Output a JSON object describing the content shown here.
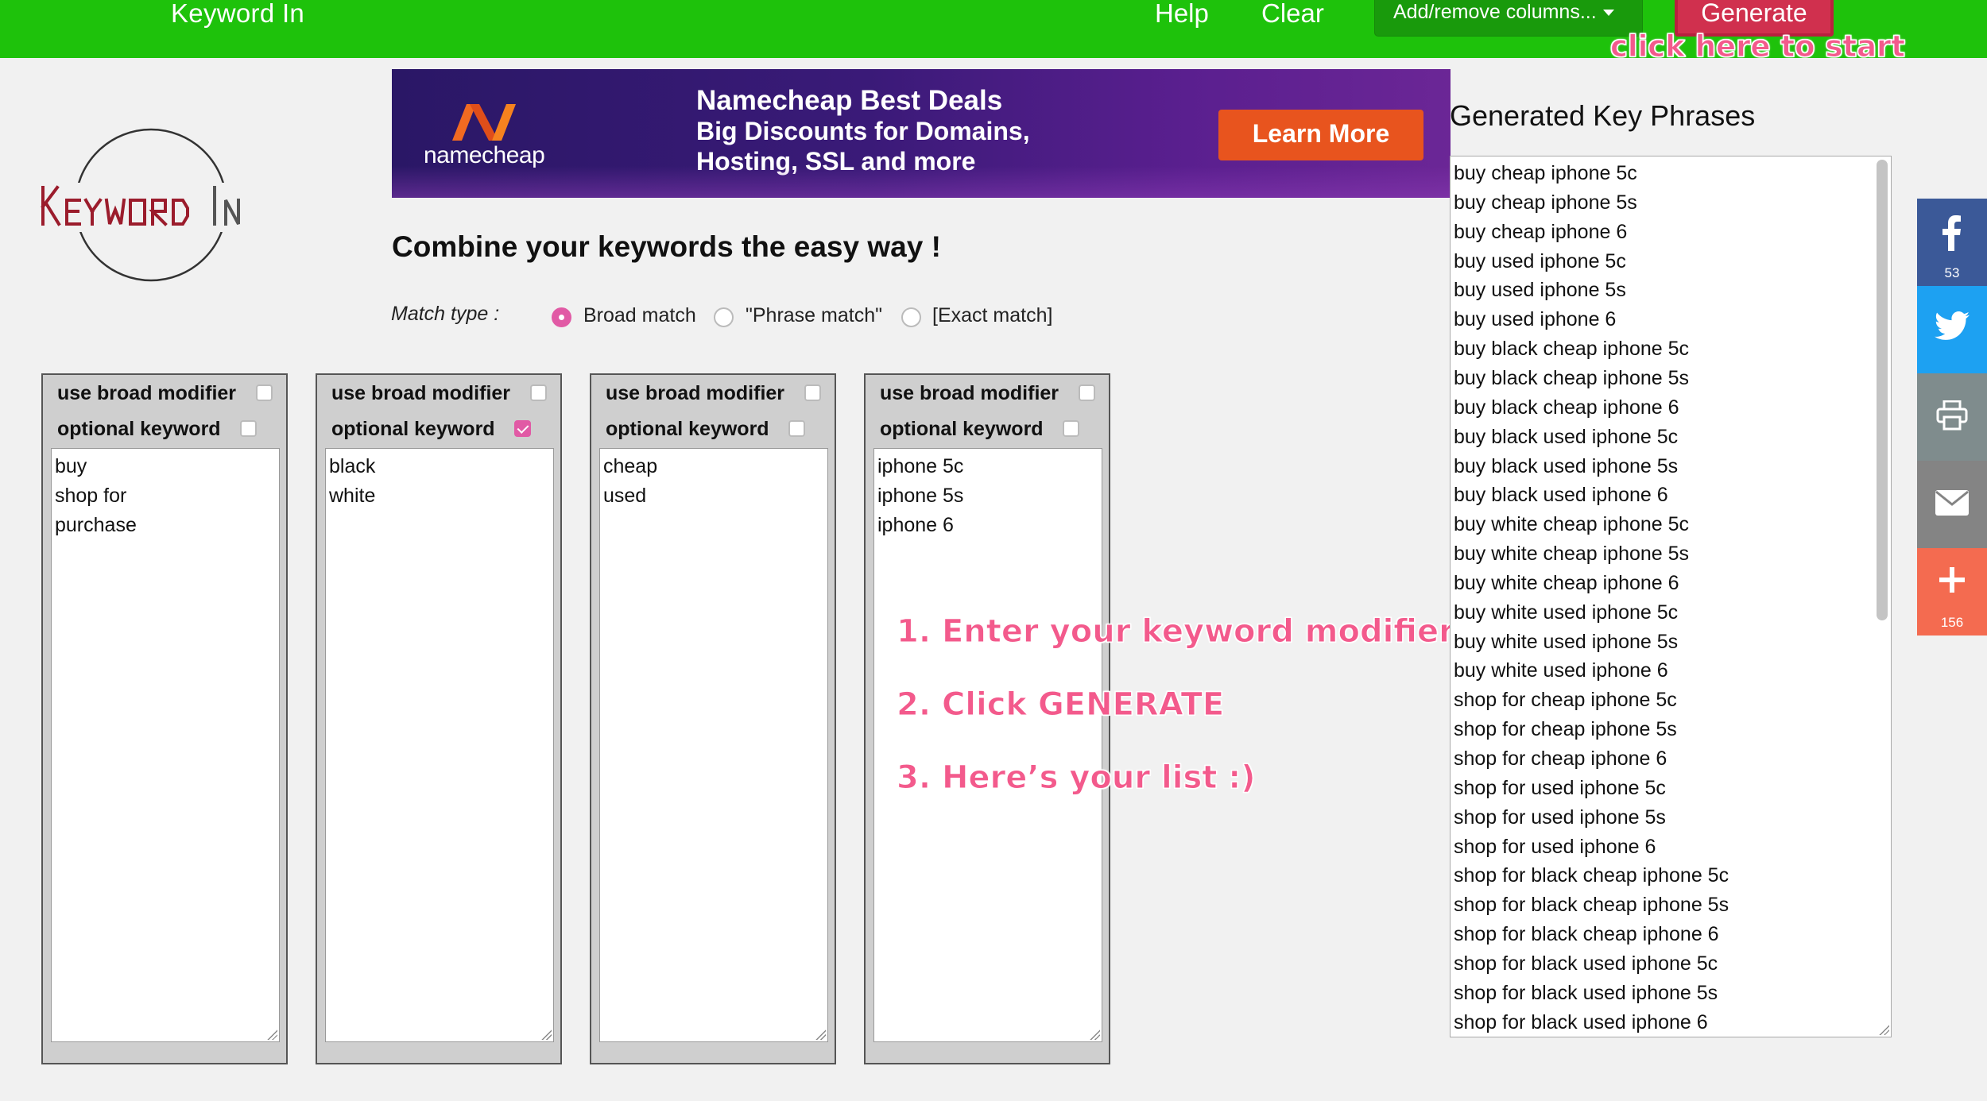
{
  "nav": {
    "brand": "Keyword In",
    "help": "Help",
    "clear": "Clear",
    "columns_menu": "Add/remove columns...",
    "generate": "Generate",
    "generate_callout": "click here to start"
  },
  "logo": {
    "text": "KeywordIn"
  },
  "ad": {
    "brand": "namecheap",
    "title": "Namecheap Best Deals",
    "line1": "Big Discounts for Domains,",
    "line2": "Hosting, SSL and more",
    "cta": "Learn More"
  },
  "heading": "Combine your keywords the easy way !",
  "match": {
    "label": "Match type :",
    "options": [
      "Broad match",
      "\"Phrase match\"",
      "[Exact match]"
    ],
    "selected": "Broad match"
  },
  "column_labels": {
    "broad": "use broad modifier",
    "optional": "optional keyword"
  },
  "columns": [
    {
      "broad_modifier": false,
      "optional": false,
      "lines": [
        "buy",
        "shop for",
        "purchase"
      ]
    },
    {
      "broad_modifier": false,
      "optional": true,
      "lines": [
        "black",
        "white"
      ]
    },
    {
      "broad_modifier": false,
      "optional": false,
      "lines": [
        "cheap",
        "used"
      ]
    },
    {
      "broad_modifier": false,
      "optional": false,
      "lines": [
        "iphone 5c",
        "iphone 5s",
        "iphone 6"
      ]
    }
  ],
  "instructions": [
    "1. Enter your keyword modifier",
    "2. Click GENERATE",
    "3. Here’s your list :)"
  ],
  "generated": {
    "title": "Generated Key Phrases",
    "phrases": [
      "buy cheap iphone 5c",
      "buy cheap iphone 5s",
      "buy cheap iphone 6",
      "buy used iphone 5c",
      "buy used iphone 5s",
      "buy used iphone 6",
      "buy black cheap iphone 5c",
      "buy black cheap iphone 5s",
      "buy black cheap iphone 6",
      "buy black used iphone 5c",
      "buy black used iphone 5s",
      "buy black used iphone 6",
      "buy white cheap iphone 5c",
      "buy white cheap iphone 5s",
      "buy white cheap iphone 6",
      "buy white used iphone 5c",
      "buy white used iphone 5s",
      "buy white used iphone 6",
      "shop for cheap iphone 5c",
      "shop for cheap iphone 5s",
      "shop for cheap iphone 6",
      "shop for used iphone 5c",
      "shop for used iphone 5s",
      "shop for used iphone 6",
      "shop for black cheap iphone 5c",
      "shop for black cheap iphone 5s",
      "shop for black cheap iphone 6",
      "shop for black used iphone 5c",
      "shop for black used iphone 5s",
      "shop for black used iphone 6"
    ]
  },
  "social": [
    {
      "icon": "facebook-icon",
      "count": "53",
      "color": "#3b5998"
    },
    {
      "icon": "twitter-icon",
      "count": "",
      "color": "#1da1f2"
    },
    {
      "icon": "print-icon",
      "count": "",
      "color": "#7f8c8d"
    },
    {
      "icon": "email-icon",
      "count": "",
      "color": "#848484"
    },
    {
      "icon": "plus-icon",
      "count": "156",
      "color": "#f46b50"
    }
  ],
  "colors": {
    "navbar": "#1ec20b",
    "generate": "#d0304e",
    "accent_pink": "#e15aa5",
    "callout": "#f35a8c"
  }
}
